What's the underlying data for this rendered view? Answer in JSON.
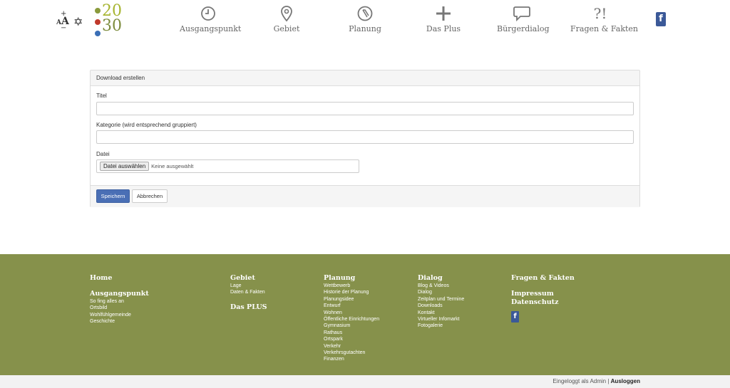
{
  "header": {
    "a11y": {
      "increase": "+",
      "decrease": "−",
      "font_label_small": "A",
      "font_label_large": "A",
      "star": "✡"
    },
    "logo": {
      "top": "20",
      "bottom": "30"
    },
    "nav": [
      {
        "label": "Ausgangspunkt",
        "icon": "clock-icon"
      },
      {
        "label": "Gebiet",
        "icon": "map-pin-icon"
      },
      {
        "label": "Planung",
        "icon": "compass-icon"
      },
      {
        "label": "Das Plus",
        "icon": "plus-icon"
      },
      {
        "label": "Bürgerdialog",
        "icon": "speech-bubble-icon"
      },
      {
        "label": "Fragen & Fakten",
        "icon": "question-exclamation-icon"
      }
    ],
    "question_glyph": "?!",
    "facebook": "f"
  },
  "form": {
    "title": "Download erstellen",
    "fields": [
      {
        "label": "Titel",
        "value": ""
      },
      {
        "label": "Kategorie (wird entsprechend gruppiert)",
        "value": ""
      }
    ],
    "file": {
      "label": "Datei",
      "button": "Datei auswählen",
      "status": "Keine ausgewählt"
    },
    "save": "Speichern",
    "cancel": "Abbrechen"
  },
  "footer": {
    "home": "Home",
    "ausgangspunkt": {
      "title": "Ausgangspunkt",
      "links": [
        "So fing alles an",
        "Ortsbild",
        "Wohlfühlgemeinde",
        "Geschichte"
      ]
    },
    "gebiet": {
      "title": "Gebiet",
      "links": [
        "Lage",
        "Daten & Fakten"
      ]
    },
    "dasplus": "Das PLUS",
    "planung": {
      "title": "Planung",
      "links": [
        "Wettbewerb",
        "Historie der Planung",
        "Planungsidee",
        "Entwurf",
        "Wohnen",
        "Öffentliche Einrichtungen",
        "Gymnasium",
        "Rathaus",
        "Ortspark",
        "Verkehr",
        "Verkehrsgutachten",
        "Finanzen"
      ]
    },
    "dialog": {
      "title": "Dialog",
      "links": [
        "Blog & Videos",
        "Dialog",
        "Zeitplan und Termine",
        "Downloads",
        "Kontakt",
        "Virtueller Infomarkt",
        "Fotogalerie"
      ]
    },
    "fragen": "Fragen & Fakten",
    "impressum": "Impressum",
    "datenschutz": "Datenschutz",
    "facebook": "f"
  },
  "bottom": {
    "status": "Eingeloggt als Admin | ",
    "logout": "Ausloggen"
  },
  "colors": {
    "footer_bg": "#86914b",
    "primary": "#4a6fb5",
    "facebook": "#3b5998"
  }
}
